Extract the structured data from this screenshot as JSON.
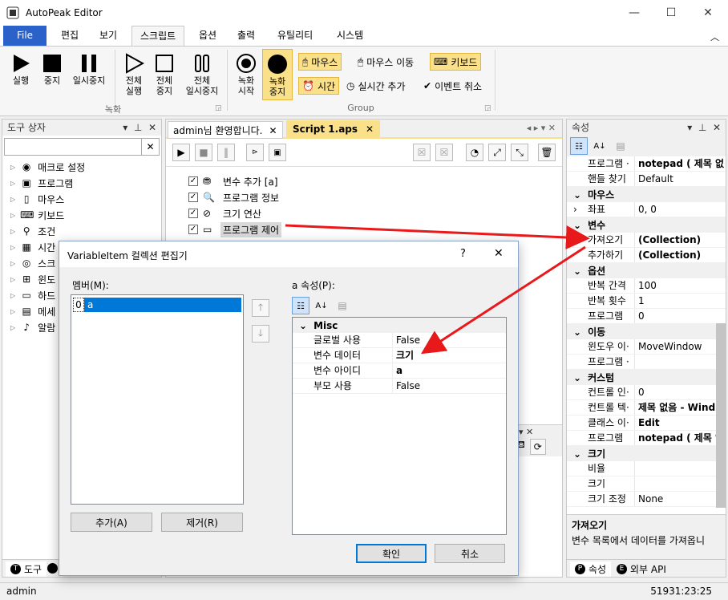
{
  "app": {
    "title": "AutoPeak Editor"
  },
  "menu_tabs": [
    "File",
    "편집",
    "보기",
    "스크립트",
    "옵션",
    "출력",
    "유틸리티",
    "시스템"
  ],
  "ribbon": {
    "run": "실행",
    "stop": "중지",
    "pause": "일시중지",
    "run_all": "전체\n실행",
    "stop_all": "전체\n중지",
    "pause_all": "전체\n일시중지",
    "record_start": "녹화\n시작",
    "record_stop": "녹화\n중지",
    "group1_label": "녹화",
    "group2_label": "Group",
    "mouse": "마우스",
    "mouse_move": "마우스 이동",
    "keyboard": "키보드",
    "time": "시간",
    "realtime_add": "실시간 추가",
    "event_cancel": "이벤트 취소"
  },
  "toolbox": {
    "title": "도구 상자",
    "items": [
      "매크로 설정",
      "프로그램",
      "마우스",
      "키보드",
      "조건",
      "시간",
      "스크",
      "윈도",
      "하드",
      "메세",
      "알람"
    ],
    "bottom_tab": "도구"
  },
  "doc_tabs": [
    "admin님 환영합니다.",
    "Script 1.aps"
  ],
  "script_items": [
    "변수 추가 [a]",
    "프로그램 정보",
    "크기 연산",
    "프로그램 제어"
  ],
  "props": {
    "title": "속성",
    "rows": [
      {
        "t": "row",
        "k": "프로그램 ·",
        "v": "notepad ( 제목 없",
        "b": true
      },
      {
        "t": "row",
        "k": "핸들 찾기",
        "v": "Default"
      },
      {
        "t": "cat",
        "k": "마우스"
      },
      {
        "t": "row",
        "k": "좌표",
        "v": "0, 0",
        "exp": true
      },
      {
        "t": "cat",
        "k": "변수"
      },
      {
        "t": "row",
        "k": "가져오기",
        "v": "(Collection)",
        "b": true
      },
      {
        "t": "row",
        "k": "추가하기",
        "v": "(Collection)",
        "b": true
      },
      {
        "t": "cat",
        "k": "옵션"
      },
      {
        "t": "row",
        "k": "반복 간격",
        "v": "100"
      },
      {
        "t": "row",
        "k": "반복 횟수",
        "v": "1"
      },
      {
        "t": "row",
        "k": "프로그램",
        "v": "0"
      },
      {
        "t": "cat",
        "k": "이동"
      },
      {
        "t": "row",
        "k": "윈도우 이·",
        "v": "MoveWindow"
      },
      {
        "t": "row",
        "k": "프로그램 ·",
        "v": ""
      },
      {
        "t": "cat",
        "k": "커스텀"
      },
      {
        "t": "row",
        "k": "컨트롤 인·",
        "v": "0"
      },
      {
        "t": "row",
        "k": "컨트롤 텍·",
        "v": "제목 없음 - Wind",
        "b": true
      },
      {
        "t": "row",
        "k": "클래스 이·",
        "v": "Edit",
        "b": true
      },
      {
        "t": "row",
        "k": "프로그램",
        "v": "notepad ( 제목 없",
        "b": true
      },
      {
        "t": "cat",
        "k": "크기"
      },
      {
        "t": "row",
        "k": "비율",
        "v": ""
      },
      {
        "t": "row",
        "k": "크기",
        "v": ""
      },
      {
        "t": "row",
        "k": "크기 조정",
        "v": "None"
      }
    ],
    "desc_title": "가져오기",
    "desc_text": "변수 목록에서 데이터를 가져옵니",
    "bottom_tabs": [
      "속성",
      "외부 API"
    ]
  },
  "dialog": {
    "title": "VariableItem 컬렉션 편집기",
    "help": "?",
    "members_label": "멤버(M):",
    "member_index": "0",
    "member_name": "a",
    "props_label": "a 속성(P):",
    "category": "Misc",
    "rows": [
      {
        "k": "글로벌 사용",
        "v": "False"
      },
      {
        "k": "변수 데이터",
        "v": "크기",
        "b": true
      },
      {
        "k": "변수 아이디",
        "v": "a",
        "b": true
      },
      {
        "k": "부모 사용",
        "v": "False"
      }
    ],
    "add": "추가(A)",
    "remove": "제거(R)",
    "ok": "확인",
    "cancel": "취소"
  },
  "status": {
    "user": "admin",
    "time": "51931:23:25"
  },
  "colors": {
    "accent": "#2b62c9",
    "highlight": "#fbe08a",
    "arrow": "#e8191b"
  }
}
